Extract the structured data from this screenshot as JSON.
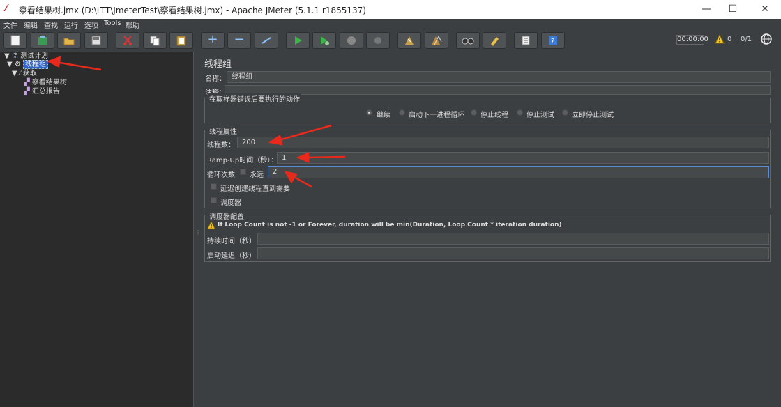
{
  "window": {
    "title": "察看结果树.jmx (D:\\LTT\\JmeterTest\\察看结果树.jmx) - Apache JMeter (5.1.1 r1855137)",
    "minimize": "—",
    "maximize": "☐",
    "close": "✕"
  },
  "menu": [
    "文件",
    "编辑",
    "查找",
    "运行",
    "选项",
    "Tools",
    "帮助"
  ],
  "toolbar": {
    "timer": "00:00:00",
    "warnings": "0",
    "threads": "0/1"
  },
  "tree": {
    "test_plan": "测试计划",
    "thread_group": "线程组",
    "sampler": "获取",
    "listener1": "察看结果树",
    "listener2": "汇总报告"
  },
  "panel": {
    "title": "线程组",
    "name_label": "名称：",
    "name_value": "线程组",
    "comment_label": "注释：",
    "comment_value": "",
    "error_group_label": "在取样器错误后要执行的动作",
    "error_options": [
      "继续",
      "启动下一进程循环",
      "停止线程",
      "停止测试",
      "立即停止测试"
    ],
    "error_selected": "继续",
    "thread_props_label": "线程属性",
    "threads_label": "线程数：",
    "threads_value": "200",
    "rampup_label": "Ramp-Up时间（秒）：",
    "rampup_value": "1",
    "loop_label": "循环次数",
    "forever_label": "永远",
    "loop_value": "2",
    "delay_create_label": "延迟创建线程直到需要",
    "scheduler_label": "调度器",
    "scheduler_config_label": "调度器配置",
    "scheduler_warning": "If Loop Count is not -1 or Forever, duration will be min(Duration, Loop Count * iteration duration)",
    "duration_label": "持续时间（秒）",
    "duration_value": "",
    "startup_delay_label": "启动延迟（秒）",
    "startup_delay_value": ""
  },
  "colors": {
    "background": "#3c3f41",
    "tree_bg": "#2b2b2b",
    "field_bg": "#45494a",
    "selection": "#2f65ca",
    "annotation_arrow": "#e8291c"
  }
}
